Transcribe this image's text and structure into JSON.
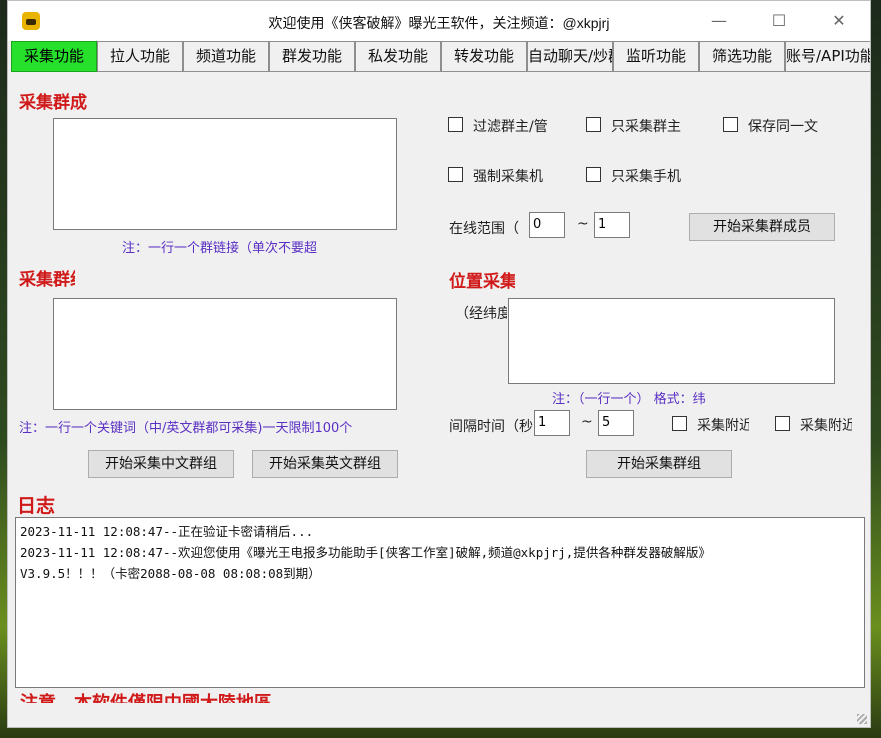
{
  "window": {
    "title": "欢迎使用《侠客破解》曝光王软件，关注频道：@xkpjrj",
    "controls": {
      "minimize": "—",
      "maximize": "☐",
      "close": "✕"
    }
  },
  "tabs": [
    {
      "label": "采集功能",
      "active": true
    },
    {
      "label": "拉人功能"
    },
    {
      "label": "频道功能"
    },
    {
      "label": "群发功能"
    },
    {
      "label": "私发功能"
    },
    {
      "label": "转发功能"
    },
    {
      "label": "自动聊天/炒群"
    },
    {
      "label": "监听功能"
    },
    {
      "label": "筛选功能"
    },
    {
      "label": "账号/API功能"
    }
  ],
  "collect_members": {
    "title": "采集群成",
    "note": "注：一行一个群链接（单次不要超",
    "options": [
      {
        "label": "过滤群主/管",
        "checked": false
      },
      {
        "label": "只采集群主",
        "checked": false
      },
      {
        "label": "保存同一文",
        "checked": false
      },
      {
        "label": "强制采集机",
        "checked": false
      },
      {
        "label": "只采集手机",
        "checked": false
      }
    ],
    "online_label": "在线范围（",
    "online_min": "0",
    "tilde": "~",
    "online_max": "1",
    "start_button": "开始采集群成员"
  },
  "collect_groups": {
    "title": "采集群组",
    "note": "注：一行一个关键词（中/英文群都可采集)一天限制100个",
    "btn_cn": "开始采集中文群组",
    "btn_en": "开始采集英文群组"
  },
  "location": {
    "title": "位置采集",
    "coord_label": "（经纬度",
    "note": "注：（一行一个） 格式：纬",
    "interval_label": "间隔时间（秒",
    "interval_min": "1",
    "tilde": "~",
    "interval_max": "5",
    "opt1": "采集附近",
    "opt2": "采集附近",
    "start_button": "开始采集群组"
  },
  "log": {
    "title": "日志",
    "lines": [
      "2023-11-11 12:08:47--正在验证卡密请稍后...",
      "2023-11-11 12:08:47--欢迎您使用《曝光王电报多功能助手[侠客工作室]破解,频道@xkpjrj,提供各种群发器破解版》",
      "V3.9.5！！！（卡密2088-08-08 08:08:08到期）"
    ]
  },
  "footer_warning": "注意，本软件僅限中國大陸地區"
}
